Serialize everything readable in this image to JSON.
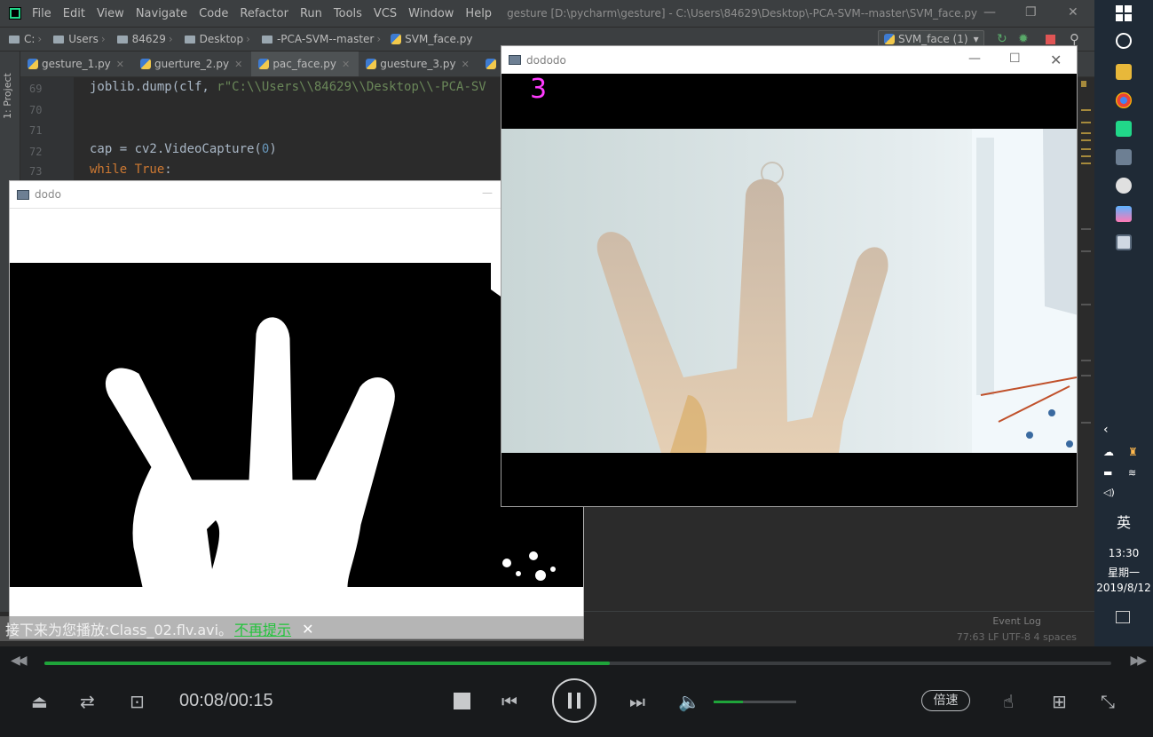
{
  "ide": {
    "menu": [
      "File",
      "Edit",
      "View",
      "Navigate",
      "Code",
      "Refactor",
      "Run",
      "Tools",
      "VCS",
      "Window",
      "Help"
    ],
    "title": "gesture [D:\\pycharm\\gesture] - C:\\Users\\84629\\Desktop\\-PCA-SVM--master\\SVM_face.py",
    "breadcrumb": [
      "C:",
      "Users",
      "84629",
      "Desktop",
      "-PCA-SVM--master",
      "SVM_face.py"
    ],
    "run_config": "SVM_face (1)",
    "project_label": "1: Project",
    "tabs": [
      "gesture_1.py",
      "guerture_2.py",
      "pac_face.py",
      "guesture_3.py"
    ],
    "lines": [
      "69",
      "70",
      "71",
      "72",
      "73"
    ],
    "code": {
      "l69_a": "joblib.dump(clf, ",
      "l69_b": "r\"C:\\\\Users\\\\84629\\\\Desktop\\\\-PCA-SV",
      "l72_a": "cap = cv2.VideoCapture(",
      "l72_num": "0",
      "l72_b": ")",
      "l73_kw": "while True",
      "l73_b": ":"
    },
    "status": {
      "event_log": "Event Log",
      "position": "77:63  LF  UTF-8  4 spaces"
    }
  },
  "taskbar": {
    "ime": "英",
    "time": "13:30",
    "weekday": "星期一",
    "date": "2019/8/12"
  },
  "dodo_window": {
    "title": "dodo"
  },
  "dododo_window": {
    "title": "dododo",
    "count": "3"
  },
  "player": {
    "next_text": "接下来为您播放:Class_02.flv.avi。",
    "next_link": "不再提示",
    "time": "00:08/00:15",
    "progress": 0.53,
    "volume": 0.36,
    "speed_label": "倍速"
  },
  "colors": {
    "accent_green": "#1fa43a",
    "count_magenta": "#ff3cff",
    "ide_bg": "#2b2b2b"
  }
}
